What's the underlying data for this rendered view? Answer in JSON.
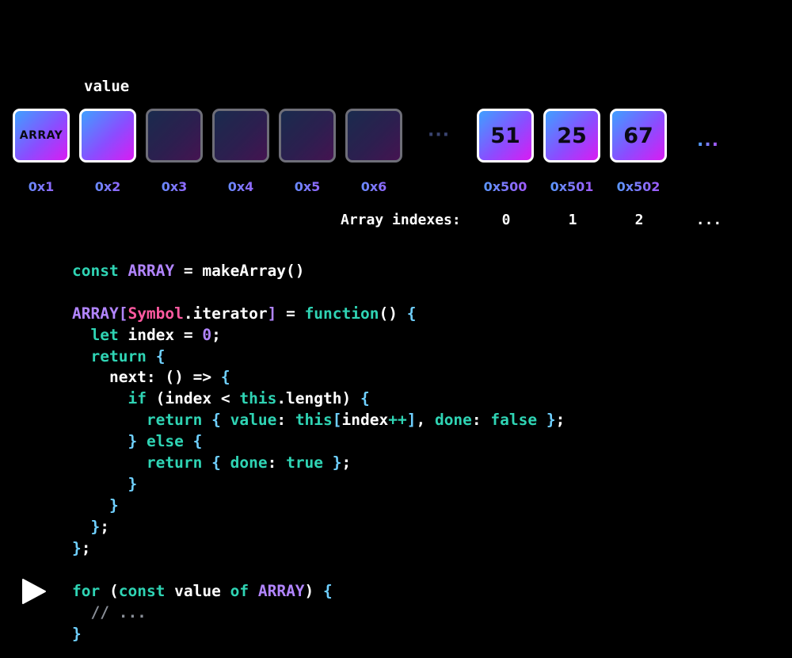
{
  "header": {
    "value_label": "value"
  },
  "memory": {
    "cells": [
      {
        "text": "ARRAY",
        "addr": "0x1",
        "dim": false,
        "size": "small"
      },
      {
        "text": "",
        "addr": "0x2",
        "dim": false,
        "size": "big"
      },
      {
        "text": "",
        "addr": "0x3",
        "dim": true,
        "size": "big"
      },
      {
        "text": "",
        "addr": "0x4",
        "dim": true,
        "size": "big"
      },
      {
        "text": "",
        "addr": "0x5",
        "dim": true,
        "size": "big"
      },
      {
        "text": "",
        "addr": "0x6",
        "dim": true,
        "size": "big"
      },
      {
        "text": "51",
        "addr": "0x500",
        "dim": false,
        "size": "big"
      },
      {
        "text": "25",
        "addr": "0x501",
        "dim": false,
        "size": "big"
      },
      {
        "text": "67",
        "addr": "0x502",
        "dim": false,
        "size": "big"
      }
    ],
    "gap_ellipsis": "···",
    "end_ellipsis": "..."
  },
  "indexes": {
    "label": "Array indexes:",
    "values": [
      "0",
      "1",
      "2",
      "..."
    ]
  },
  "code": {
    "lines": [
      [
        {
          "t": "const ",
          "c": "kw"
        },
        {
          "t": "ARRAY",
          "c": "arr"
        },
        {
          "t": " = makeArray()",
          "c": ""
        }
      ],
      [],
      [
        {
          "t": "ARRAY",
          "c": "arr"
        },
        {
          "t": "[",
          "c": "arr"
        },
        {
          "t": "Symbol",
          "c": "sym"
        },
        {
          "t": ".iterator",
          "c": ""
        },
        {
          "t": "]",
          "c": "arr"
        },
        {
          "t": " = ",
          "c": ""
        },
        {
          "t": "function",
          "c": "kw"
        },
        {
          "t": "() ",
          "c": ""
        },
        {
          "t": "{",
          "c": "brace"
        }
      ],
      [
        {
          "t": "  ",
          "c": ""
        },
        {
          "t": "let",
          "c": "kw"
        },
        {
          "t": " index = ",
          "c": ""
        },
        {
          "t": "0",
          "c": "num"
        },
        {
          "t": ";",
          "c": ""
        }
      ],
      [
        {
          "t": "  ",
          "c": ""
        },
        {
          "t": "return",
          "c": "kw"
        },
        {
          "t": " ",
          "c": ""
        },
        {
          "t": "{",
          "c": "brace"
        }
      ],
      [
        {
          "t": "    next: () => ",
          "c": ""
        },
        {
          "t": "{",
          "c": "brace"
        }
      ],
      [
        {
          "t": "      ",
          "c": ""
        },
        {
          "t": "if",
          "c": "kw"
        },
        {
          "t": " (index < ",
          "c": ""
        },
        {
          "t": "this",
          "c": "kw"
        },
        {
          "t": ".length) ",
          "c": ""
        },
        {
          "t": "{",
          "c": "brace"
        }
      ],
      [
        {
          "t": "        ",
          "c": ""
        },
        {
          "t": "return",
          "c": "kw"
        },
        {
          "t": " ",
          "c": ""
        },
        {
          "t": "{",
          "c": "brace"
        },
        {
          "t": " ",
          "c": ""
        },
        {
          "t": "value",
          "c": "kw"
        },
        {
          "t": ": ",
          "c": ""
        },
        {
          "t": "this",
          "c": "kw"
        },
        {
          "t": "[",
          "c": "brace"
        },
        {
          "t": "index",
          "c": ""
        },
        {
          "t": "++",
          "c": "kw"
        },
        {
          "t": "]",
          "c": "brace"
        },
        {
          "t": ", ",
          "c": ""
        },
        {
          "t": "done",
          "c": "kw"
        },
        {
          "t": ": ",
          "c": ""
        },
        {
          "t": "false",
          "c": "kw"
        },
        {
          "t": " ",
          "c": ""
        },
        {
          "t": "}",
          "c": "brace"
        },
        {
          "t": ";",
          "c": ""
        }
      ],
      [
        {
          "t": "      ",
          "c": ""
        },
        {
          "t": "}",
          "c": "brace"
        },
        {
          "t": " ",
          "c": ""
        },
        {
          "t": "else",
          "c": "kw"
        },
        {
          "t": " ",
          "c": ""
        },
        {
          "t": "{",
          "c": "brace"
        }
      ],
      [
        {
          "t": "        ",
          "c": ""
        },
        {
          "t": "return",
          "c": "kw"
        },
        {
          "t": " ",
          "c": ""
        },
        {
          "t": "{",
          "c": "brace"
        },
        {
          "t": " ",
          "c": ""
        },
        {
          "t": "done",
          "c": "kw"
        },
        {
          "t": ": ",
          "c": ""
        },
        {
          "t": "true",
          "c": "kw"
        },
        {
          "t": " ",
          "c": ""
        },
        {
          "t": "}",
          "c": "brace"
        },
        {
          "t": ";",
          "c": ""
        }
      ],
      [
        {
          "t": "      ",
          "c": ""
        },
        {
          "t": "}",
          "c": "brace"
        }
      ],
      [
        {
          "t": "    ",
          "c": ""
        },
        {
          "t": "}",
          "c": "brace"
        }
      ],
      [
        {
          "t": "  ",
          "c": ""
        },
        {
          "t": "}",
          "c": "brace"
        },
        {
          "t": ";",
          "c": ""
        }
      ],
      [
        {
          "t": "}",
          "c": "brace"
        },
        {
          "t": ";",
          "c": ""
        }
      ]
    ],
    "loop_lines": [
      [
        {
          "t": "for",
          "c": "kw"
        },
        {
          "t": " (",
          "c": ""
        },
        {
          "t": "const",
          "c": "kw"
        },
        {
          "t": " value ",
          "c": ""
        },
        {
          "t": "of",
          "c": "kw"
        },
        {
          "t": " ",
          "c": ""
        },
        {
          "t": "ARRAY",
          "c": "arr"
        },
        {
          "t": ") ",
          "c": ""
        },
        {
          "t": "{",
          "c": "brace"
        }
      ],
      [
        {
          "t": "  ",
          "c": ""
        },
        {
          "t": "// ...",
          "c": "cmt"
        }
      ],
      [
        {
          "t": "}",
          "c": "brace"
        }
      ]
    ]
  },
  "colors": {
    "keyword": "#2fd4b4",
    "array_ident": "#b285ff",
    "symbol": "#ff5aa0",
    "brace": "#6fd0ff",
    "comment": "#8a8f98"
  },
  "icons": {
    "play": "play-icon"
  }
}
